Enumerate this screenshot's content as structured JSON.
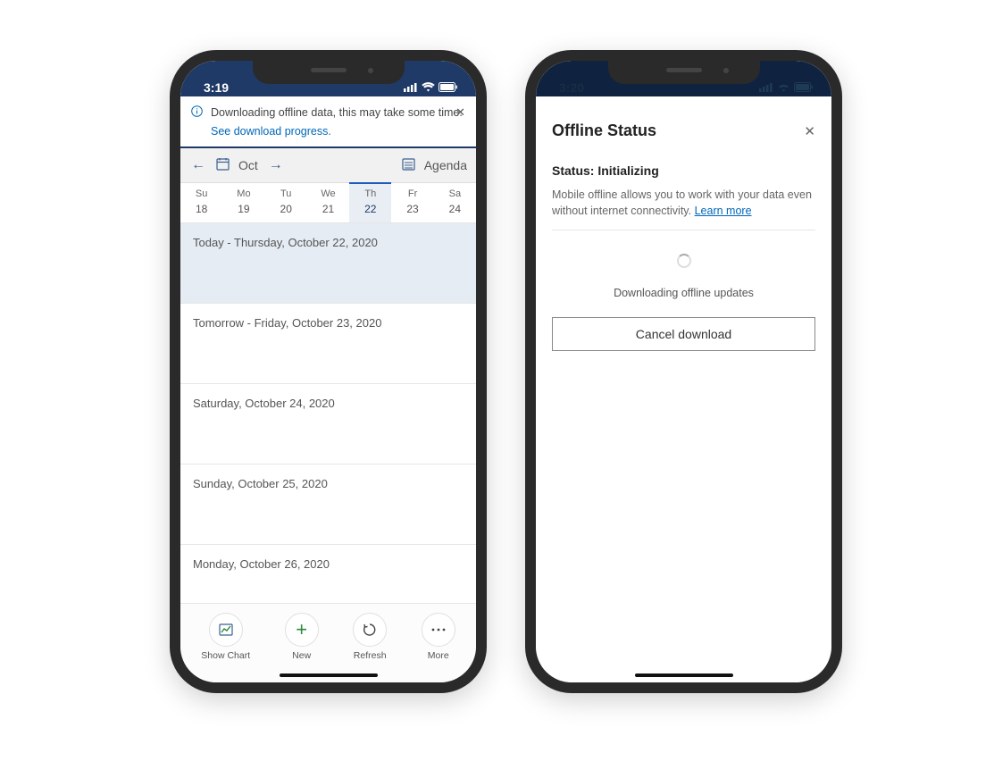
{
  "left": {
    "status_time": "3:19",
    "banner": {
      "message": "Downloading offline data, this may take some time.",
      "link_text": "See download progress."
    },
    "calendar": {
      "month_label": "Oct",
      "agenda_label": "Agenda",
      "day_heads": [
        "Su",
        "Mo",
        "Tu",
        "We",
        "Th",
        "Fr",
        "Sa"
      ],
      "day_nums": [
        "18",
        "19",
        "20",
        "21",
        "22",
        "23",
        "24"
      ],
      "selected_index": 4
    },
    "agenda": [
      "Today - Thursday, October 22, 2020",
      "Tomorrow - Friday, October 23, 2020",
      "Saturday, October 24, 2020",
      "Sunday, October 25, 2020",
      "Monday, October 26, 2020"
    ],
    "bottom": {
      "show_chart": "Show Chart",
      "new": "New",
      "refresh": "Refresh",
      "more": "More"
    }
  },
  "right": {
    "status_time": "3:20",
    "title": "Offline Status",
    "status_line": "Status: Initializing",
    "description": "Mobile offline allows you to work with your data even without internet connectivity.",
    "learn_more": "Learn more",
    "downloading_text": "Downloading offline updates",
    "cancel_label": "Cancel download"
  }
}
